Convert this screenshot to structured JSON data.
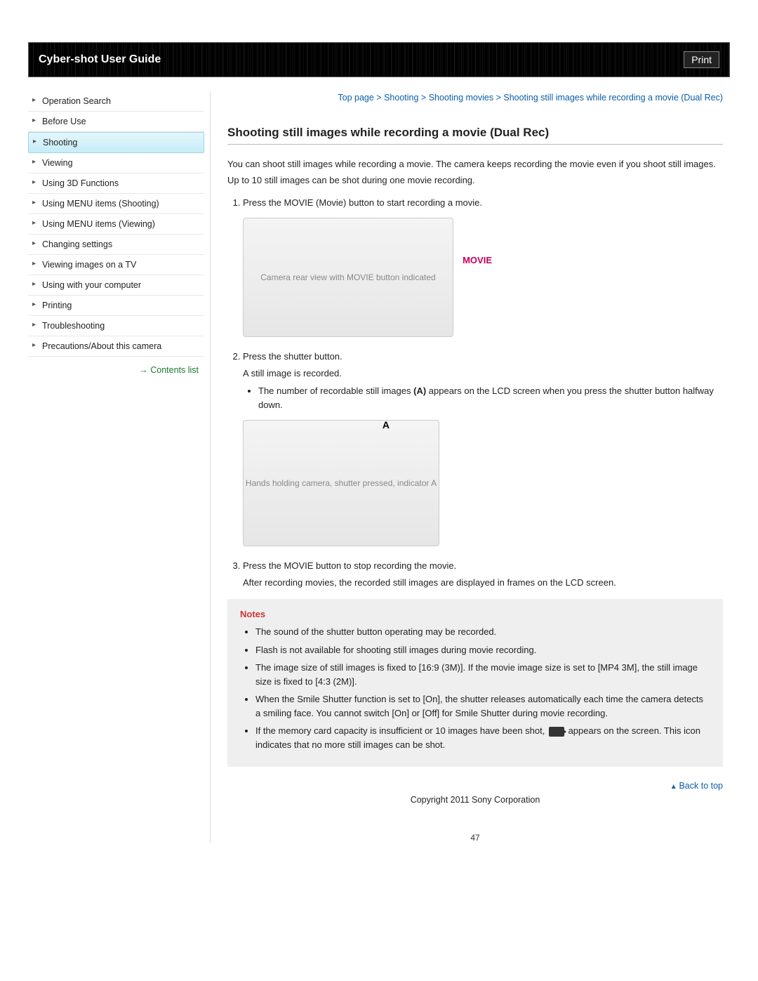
{
  "header": {
    "title": "Cyber-shot User Guide",
    "print": "Print"
  },
  "sidebar": {
    "items": [
      "Operation Search",
      "Before Use",
      "Shooting",
      "Viewing",
      "Using 3D Functions",
      "Using MENU items (Shooting)",
      "Using MENU items (Viewing)",
      "Changing settings",
      "Viewing images on a TV",
      "Using with your computer",
      "Printing",
      "Troubleshooting",
      "Precautions/About this camera"
    ],
    "active_index": 2,
    "contents_link": "Contents list"
  },
  "breadcrumb": {
    "parts": [
      "Top page",
      "Shooting",
      "Shooting movies",
      "Shooting still images while recording a movie (Dual Rec)"
    ],
    "sep": " > "
  },
  "article": {
    "title": "Shooting still images while recording a movie (Dual Rec)",
    "intro1": "You can shoot still images while recording a movie. The camera keeps recording the movie even if you shoot still images.",
    "intro2": "Up to 10 still images can be shot during one movie recording.",
    "step1": "Press the MOVIE (Movie) button to start recording a movie.",
    "fig1_label": "MOVIE",
    "fig1_alt": "Camera rear view with MOVIE button indicated",
    "step2a": "Press the shutter button.",
    "step2b": "A still image is recorded.",
    "step2_bullet_pre": "The number of recordable still images ",
    "step2_bullet_bold": "(A)",
    "step2_bullet_post": " appears on the LCD screen when you press the shutter button halfway down.",
    "fig2_label": "A",
    "fig2_alt": "Hands holding camera, shutter pressed, indicator A",
    "step3a": "Press the MOVIE button to stop recording the movie.",
    "step3b": "After recording movies, the recorded still images are displayed in frames on the LCD screen.",
    "notes_title": "Notes",
    "notes": [
      "The sound of the shutter button operating may be recorded.",
      "Flash is not available for shooting still images during movie recording.",
      "The image size of still images is fixed to [16:9 (3M)]. If the movie image size is set to [MP4 3M], the still image size is fixed to [4:3 (2M)].",
      "When the Smile Shutter function is set to [On], the shutter releases automatically each time the camera detects a smiling face. You cannot switch [On] or [Off] for Smile Shutter during movie recording."
    ],
    "note5_pre": "If the memory card capacity is insufficient or 10 images have been shot, ",
    "note5_post": " appears on the screen. This icon indicates that no more still images can be shot.",
    "back_to_top": "Back to top",
    "copyright": "Copyright 2011 Sony Corporation",
    "page_number": "47"
  }
}
